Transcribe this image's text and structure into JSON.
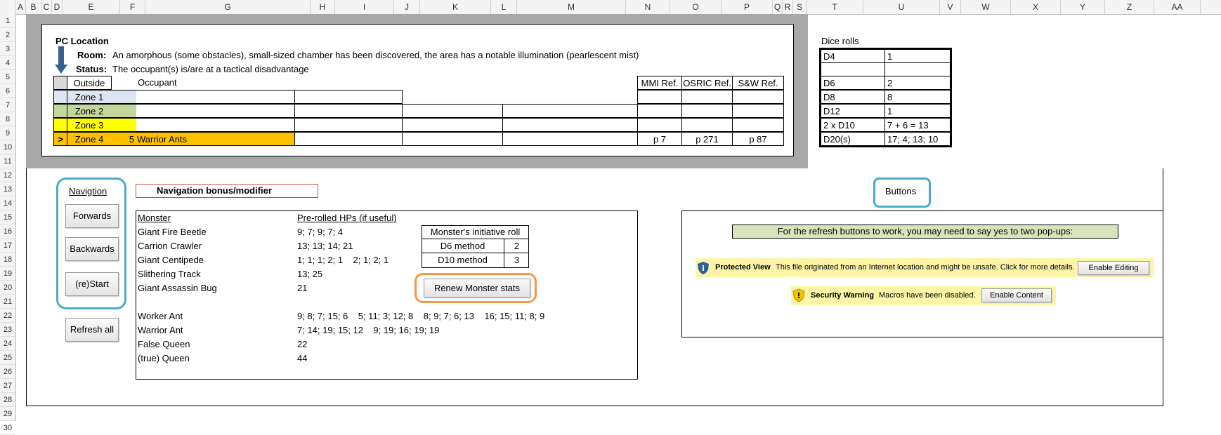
{
  "columns": [
    "A",
    "B",
    "C",
    "D",
    "E",
    "F",
    "G",
    "H",
    "I",
    "J",
    "K",
    "L",
    "M",
    "N",
    "O",
    "P",
    "Q",
    "R",
    "S",
    "T",
    "U",
    "V",
    "W",
    "X",
    "Y",
    "Z",
    "AA"
  ],
  "rows": [
    "1",
    "2",
    "3",
    "4",
    "5",
    "6",
    "7",
    "8",
    "9",
    "10",
    "11",
    "12",
    "13",
    "14",
    "15",
    "16",
    "17",
    "18",
    "19",
    "20",
    "21",
    "22",
    "23",
    "24",
    "25",
    "26",
    "27",
    "28",
    "29",
    "30"
  ],
  "pc": {
    "title": "PC Location",
    "room_label": "Room:",
    "room_value": "An amorphous (some obstacles), small-sized chamber has been discovered, the area has a notable illumination (pearlescent  mist)",
    "status_label": "Status:",
    "status_value": "The occupant(s) is/are at a tactical disadvantage"
  },
  "zones": {
    "outside_header": "Outside",
    "occupant_header": "Occupant",
    "mmi_header": "MMI Ref.",
    "osric_header": "OSRIC Ref.",
    "sw_header": "S&W Ref.",
    "zone1": "Zone 1",
    "zone2": "Zone 2",
    "zone3": "Zone 3",
    "zone4": "Zone 4",
    "marker": ">",
    "count": "5",
    "occupant": "Warrior Ants",
    "mmi": "p 7",
    "osric": "p 271",
    "sw": "p 87"
  },
  "dice": {
    "title": "Dice rolls",
    "rows": [
      {
        "label": "D4",
        "value": "1"
      },
      {
        "label": "",
        "value": ""
      },
      {
        "label": "D6",
        "value": "2"
      },
      {
        "label": "D8",
        "value": "8"
      },
      {
        "label": "D12",
        "value": "1"
      },
      {
        "label": "2 x D10",
        "value": "7 + 6 = 13"
      },
      {
        "label": "D20(s)",
        "value": "17;  4;  13;  10"
      }
    ]
  },
  "nav": {
    "title": "Navigtion",
    "forwards": "Forwards",
    "backwards": "Backwards",
    "restart": "(re)Start",
    "refresh": "Refresh all",
    "bonus": "Navigation bonus/modifier"
  },
  "monsters": {
    "header_monster": "Monster",
    "header_hp": "Pre-rolled HPs (if useful)",
    "list": [
      {
        "name": "Giant Fire Beetle",
        "hp": "9; 7; 9; 7; 4"
      },
      {
        "name": "Carrion Crawler",
        "hp": "13; 13; 14; 21"
      },
      {
        "name": "Giant Centipede",
        "hp": "1; 1; 1; 2; 1    2; 1; 2; 1"
      },
      {
        "name": "Slithering Track",
        "hp": "13; 25"
      },
      {
        "name": "Giant Assassin Bug",
        "hp": "21"
      },
      {
        "name": "Worker Ant",
        "hp": "9; 8; 7; 15; 6    5; 11; 3; 12; 8    8; 9; 7; 6; 13    16; 15; 11; 8; 9"
      },
      {
        "name": "Warrior Ant",
        "hp": "7; 14; 19; 15; 12    9; 19; 16; 19; 19"
      },
      {
        "name": "False Queen",
        "hp": "22"
      },
      {
        "name": "(true) Queen",
        "hp": "44"
      }
    ],
    "initiative_title": "Monster's initiative roll",
    "d6_label": "D6 method",
    "d6_value": "2",
    "d10_label": "D10 method",
    "d10_value": "3",
    "renew_button": "Renew Monster stats"
  },
  "buttons_panel": {
    "label": "Buttons",
    "notice": "For the refresh buttons to work, you may need to say yes to two pop-ups:",
    "protected_title": "Protected View",
    "protected_text": "This file originated from an Internet location and might be unsafe. Click for more details.",
    "enable_editing": "Enable Editing",
    "security_title": "Security Warning",
    "security_text": "Macros have been disabled.",
    "enable_content": "Enable Content"
  },
  "colors": {
    "zone1": "#dce6f1",
    "zone2": "#c4d79b",
    "zone3": "#ffff00",
    "zone4": "#ffc000",
    "teal_frame": "#4bacc6",
    "orange_frame": "#f79646",
    "notice_bg": "#d8e4bc",
    "bar_yellow": "#fcf5a8"
  }
}
